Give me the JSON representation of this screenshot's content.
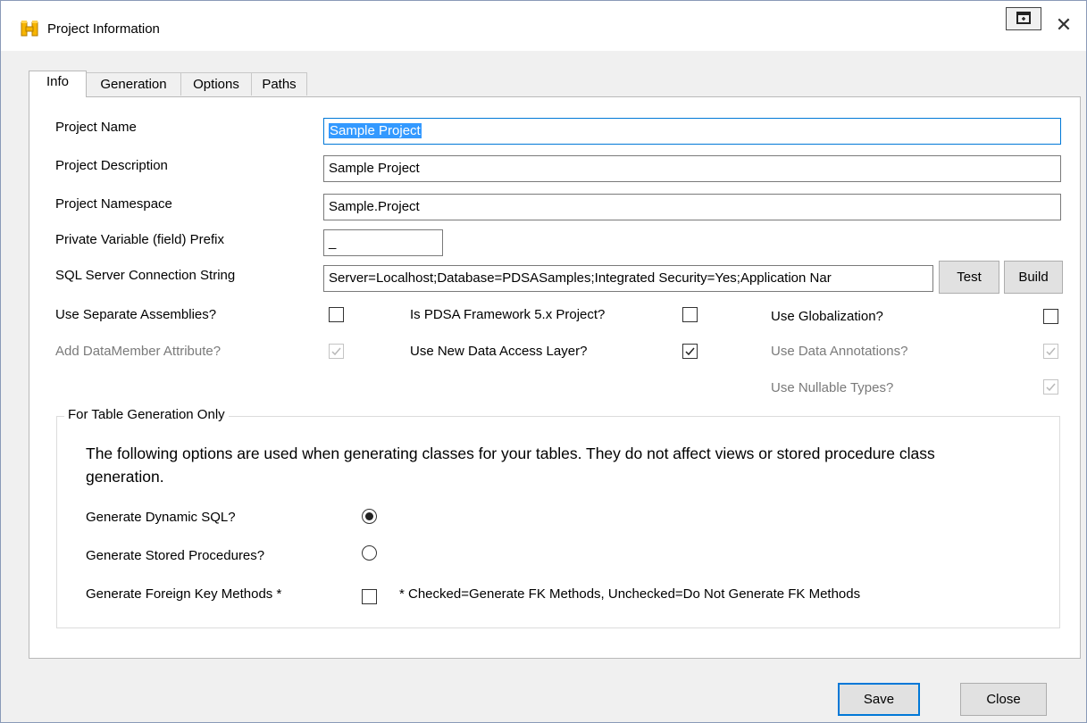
{
  "window": {
    "title": "Project Information",
    "icon": "project-app-icon",
    "restore_icon": "restore-window-icon",
    "close_glyph": "✕"
  },
  "tabs": [
    {
      "label": "Info",
      "active": true
    },
    {
      "label": "Generation",
      "active": false
    },
    {
      "label": "Options",
      "active": false
    },
    {
      "label": "Paths",
      "active": false
    }
  ],
  "info": {
    "project_name": {
      "label": "Project Name",
      "value": "Sample Project"
    },
    "project_description": {
      "label": "Project Description",
      "value": "Sample Project"
    },
    "project_namespace": {
      "label": "Project Namespace",
      "value": "Sample.Project"
    },
    "field_prefix": {
      "label": "Private Variable (field) Prefix",
      "value": "_"
    },
    "connection_string": {
      "label": "SQL Server Connection String",
      "value": "Server=Localhost;Database=PDSASamples;Integrated Security=Yes;Application Nar",
      "test_label": "Test",
      "build_label": "Build"
    },
    "checkboxes": {
      "separate_assemblies": {
        "label": "Use Separate Assemblies?",
        "checked": false,
        "enabled": true
      },
      "datamember_attribute": {
        "label": "Add DataMember Attribute?",
        "checked": true,
        "enabled": false
      },
      "pdsa_framework": {
        "label": "Is PDSA Framework 5.x Project?",
        "checked": false,
        "enabled": true
      },
      "new_data_access": {
        "label": "Use New Data Access Layer?",
        "checked": true,
        "enabled": true
      },
      "globalization": {
        "label": "Use Globalization?",
        "checked": false,
        "enabled": true
      },
      "data_annotations": {
        "label": "Use Data Annotations?",
        "checked": true,
        "enabled": false
      },
      "nullable_types": {
        "label": "Use Nullable Types?",
        "checked": true,
        "enabled": false
      }
    }
  },
  "table_generation": {
    "legend": "For Table Generation Only",
    "description": "The following options are used when generating classes for your tables. They do not affect views or stored procedure class generation.",
    "dynamic_sql": {
      "label": "Generate Dynamic SQL?",
      "selected": true
    },
    "stored_procedures": {
      "label": "Generate Stored Procedures?",
      "selected": false
    },
    "foreign_key": {
      "label": "Generate Foreign Key Methods *",
      "checked": false,
      "note": "* Checked=Generate FK Methods, Unchecked=Do Not Generate FK Methods"
    }
  },
  "footer": {
    "save_label": "Save",
    "close_label": "Close"
  },
  "colors": {
    "accent": "#0078d7",
    "selection": "#3399ff",
    "window_bg": "#f0f0f0",
    "disabled_text": "#7a7a7a"
  }
}
